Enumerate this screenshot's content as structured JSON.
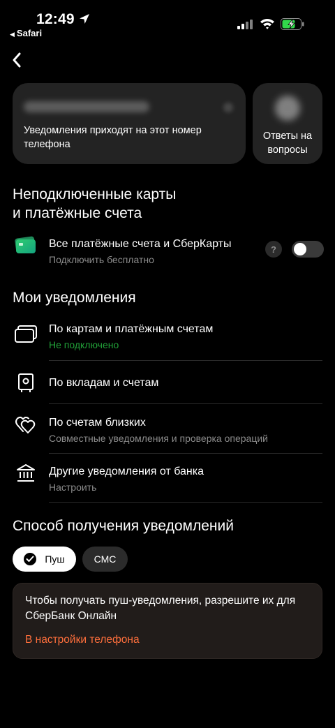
{
  "status_bar": {
    "time": "12:49",
    "back_app": "Safari"
  },
  "contact_card": {
    "phone_masked": "",
    "text": "Уведомления приходят на этот номер телефона"
  },
  "faq_card": {
    "label": "Ответы на вопросы"
  },
  "unconnected": {
    "title_line1": "Неподключенные карты",
    "title_line2": "и платёжные счета",
    "item": {
      "title": "Все платёжные счета и СберКарты",
      "subtitle": "Подключить бесплатно",
      "help": "?",
      "toggle_on": false
    }
  },
  "my_notifications": {
    "title": "Мои уведомления",
    "items": [
      {
        "title": "По картам и платёжным счетам",
        "subtitle": "Не подключено",
        "icon": "cards-icon"
      },
      {
        "title": "По вкладам и счетам",
        "subtitle": "",
        "icon": "safe-icon"
      },
      {
        "title": "По счетам близких",
        "subtitle": "Совместные уведомления и проверка операций",
        "icon": "hearts-icon"
      },
      {
        "title": "Другие уведомления от банка",
        "subtitle": "Настроить",
        "icon": "bank-icon"
      }
    ]
  },
  "delivery": {
    "title": "Способ получения уведомлений",
    "options": [
      {
        "label": "Пуш",
        "selected": true
      },
      {
        "label": "СМС",
        "selected": false
      }
    ]
  },
  "info": {
    "text": "Чтобы получать пуш-уведомления, разрешите их для СберБанк Онлайн",
    "link": "В настройки телефона"
  },
  "colors": {
    "background": "#000000",
    "card": "#232323",
    "accent_green": "#21a038",
    "link_orange": "#ff6f3c",
    "muted_text": "#8c8c8c"
  }
}
